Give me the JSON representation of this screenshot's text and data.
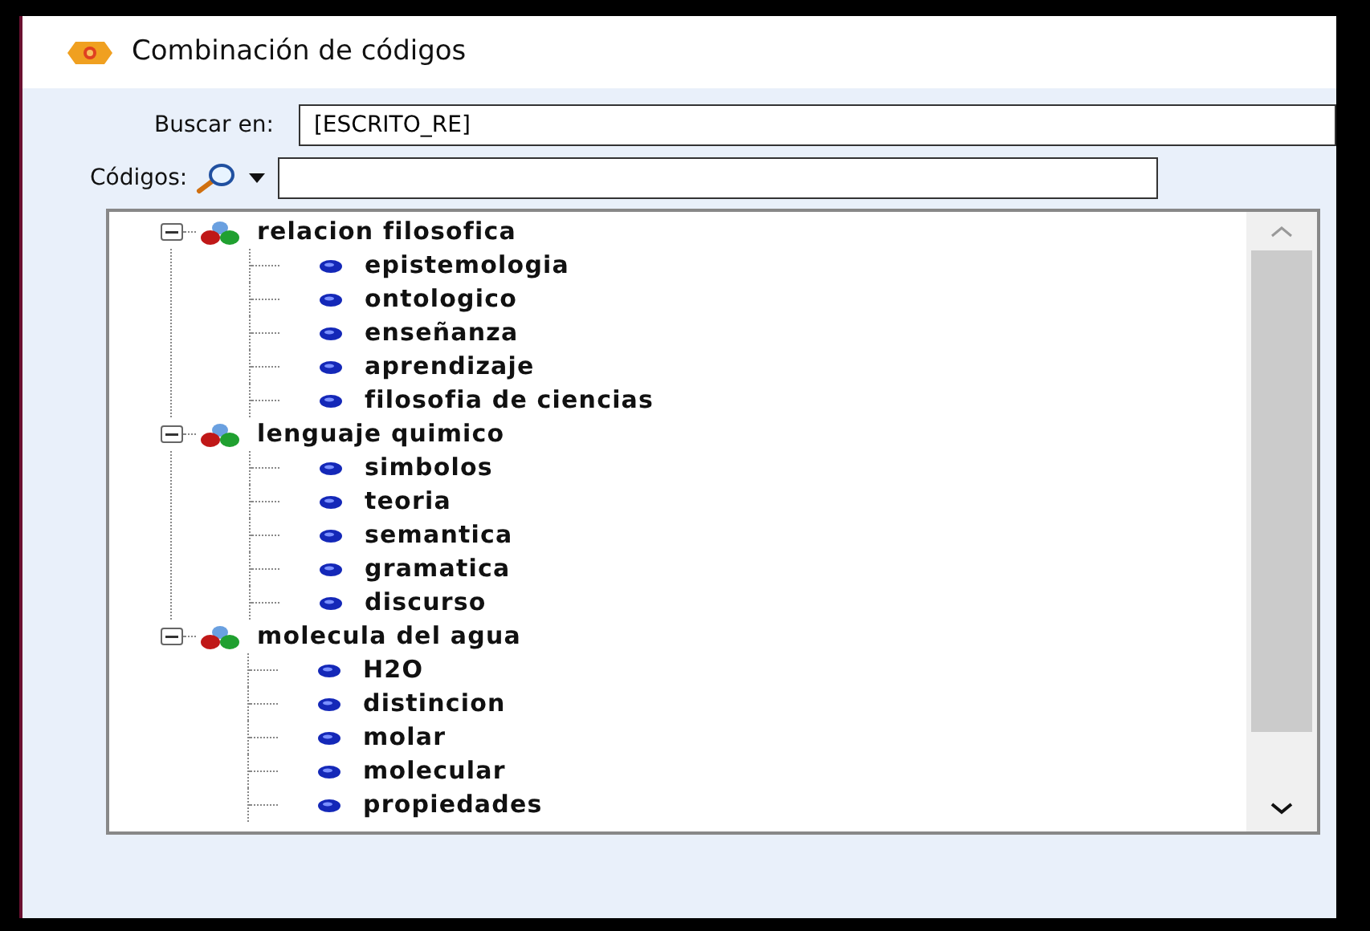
{
  "window": {
    "title": "Combinación de códigos"
  },
  "search_in": {
    "label": "Buscar en:",
    "value": "[ESCRITO_RE]"
  },
  "codes": {
    "label": "Códigos:"
  },
  "tree": {
    "items": [
      {
        "label": "relacion filosofica",
        "expanded": true,
        "children": [
          {
            "label": "epistemologia"
          },
          {
            "label": "ontologico"
          },
          {
            "label": "enseñanza"
          },
          {
            "label": "aprendizaje"
          },
          {
            "label": "filosofia de ciencias"
          }
        ]
      },
      {
        "label": "lenguaje quimico",
        "expanded": true,
        "children": [
          {
            "label": "simbolos"
          },
          {
            "label": "teoria"
          },
          {
            "label": "semantica"
          },
          {
            "label": "gramatica"
          },
          {
            "label": "discurso"
          }
        ]
      },
      {
        "label": "molecula del agua",
        "expanded": true,
        "children": [
          {
            "label": "H2O"
          },
          {
            "label": "distincion"
          },
          {
            "label": "molar"
          },
          {
            "label": "molecular"
          },
          {
            "label": "propiedades"
          }
        ]
      }
    ]
  }
}
